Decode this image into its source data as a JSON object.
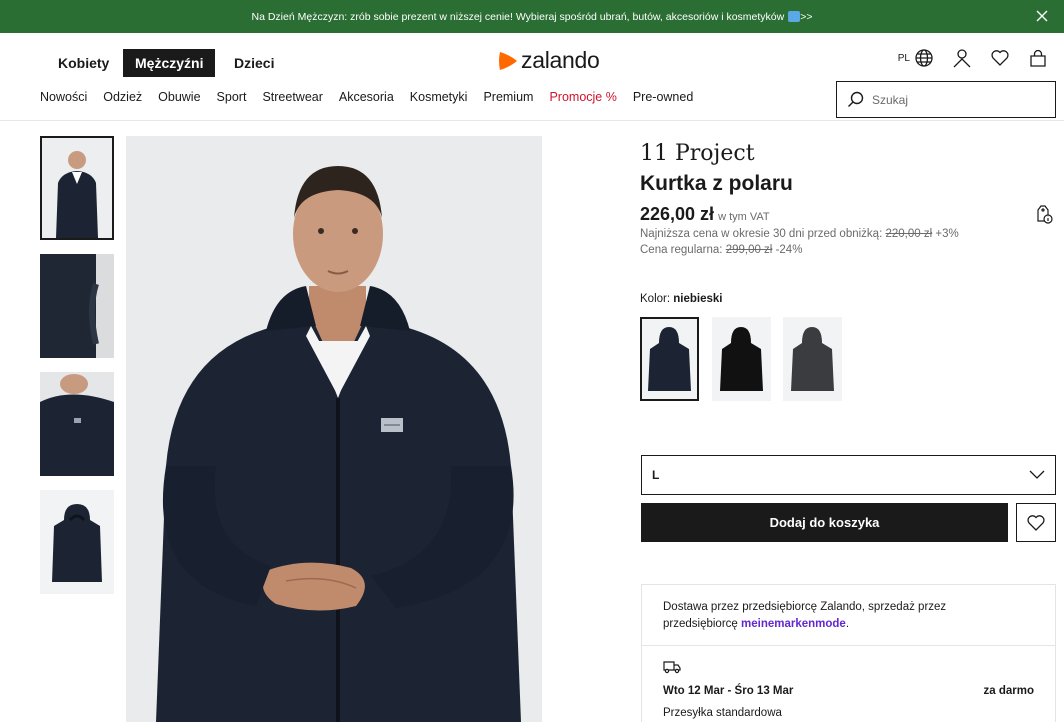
{
  "promo": {
    "text": "Na Dzień Mężczyzn: zrób sobie prezent w niższej cenie! Wybieraj spośród ubrań, butów, akcesoriów i kosmetyków",
    "suffix": ">>"
  },
  "header": {
    "genders": [
      "Kobiety",
      "Mężczyźni",
      "Dzieci"
    ],
    "logo": "zalando",
    "lang": "PL"
  },
  "nav": [
    "Nowości",
    "Odzież",
    "Obuwie",
    "Sport",
    "Streetwear",
    "Akcesoria",
    "Kosmetyki",
    "Premium",
    "Promocje %",
    "Pre-owned"
  ],
  "search": {
    "placeholder": "Szukaj"
  },
  "product": {
    "brand": "11 Project",
    "name": "Kurtka z polaru",
    "price": "226,00 zł",
    "vat": "w tym VAT",
    "lowest_label": "Najniższa cena w okresie 30 dni przed obniżką:",
    "lowest_price": "220,00 zł",
    "lowest_diff": "+3%",
    "regular_label": "Cena regularna:",
    "regular_price": "299,00 zł",
    "regular_diff": "-24%",
    "color_label": "Kolor:",
    "color_value": "niebieski",
    "size": "L",
    "add_button": "Dodaj do koszyka"
  },
  "delivery": {
    "text": "Dostawa przez przedsiębiorcę Zalando, sprzedaż przez przedsiębiorcę",
    "seller": "meinemarkenmode",
    "dates": "Wto 12 Mar - Śro 13 Mar",
    "cost": "za darmo",
    "method": "Przesyłka standardowa"
  },
  "colors": {
    "promo_bg": "#2a6e33",
    "logo_orange": "#ff6900",
    "sale_red": "#d0142c",
    "seller_purple": "#6328d0",
    "jacket": "#1c2433"
  }
}
